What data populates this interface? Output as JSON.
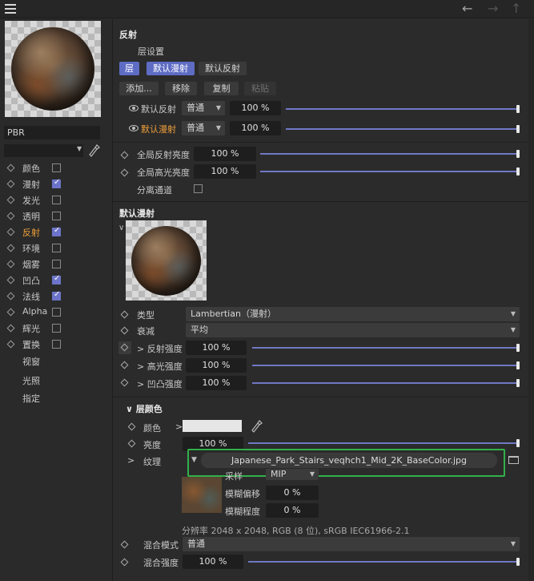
{
  "topbar": {
    "menu_icon": "hamburger-icon",
    "back_icon": "arrow-left-icon",
    "forward_icon": "arrow-right-icon",
    "up_icon": "arrow-up-icon"
  },
  "material": {
    "name": "PBR",
    "dropdown_value": ""
  },
  "channels": [
    {
      "label": "颜色",
      "checked": false,
      "active": false
    },
    {
      "label": "漫射",
      "checked": true,
      "active": false
    },
    {
      "label": "发光",
      "checked": false,
      "active": false
    },
    {
      "label": "透明",
      "checked": false,
      "active": false
    },
    {
      "label": "反射",
      "checked": true,
      "active": true
    },
    {
      "label": "环境",
      "checked": false,
      "active": false
    },
    {
      "label": "烟雾",
      "checked": false,
      "active": false
    },
    {
      "label": "凹凸",
      "checked": true,
      "active": false
    },
    {
      "label": "法线",
      "checked": true,
      "active": false
    },
    {
      "label": "Alpha",
      "checked": false,
      "active": false
    },
    {
      "label": "辉光",
      "checked": false,
      "active": false
    },
    {
      "label": "置换",
      "checked": false,
      "active": false
    }
  ],
  "extra_items": [
    "视窗",
    "光照",
    "指定"
  ],
  "reflection": {
    "title": "反射",
    "layer_settings": "层设置",
    "tabs": [
      "层",
      "默认漫射",
      "默认反射"
    ],
    "actions": [
      "添加...",
      "移除",
      "复制",
      "粘贴"
    ],
    "layers": [
      {
        "name": "默认反射",
        "mode": "普通",
        "value": "100 %",
        "active": false
      },
      {
        "name": "默认漫射",
        "mode": "普通",
        "value": "100 %",
        "active": true
      }
    ],
    "global_refl_label": "全局反射亮度",
    "global_refl_value": "100 %",
    "global_spec_label": "全局高光亮度",
    "global_spec_value": "100 %",
    "separate_pass_label": "分离通道"
  },
  "diffuse": {
    "title": "默认漫射",
    "type_label": "类型",
    "type_value": "Lambertian（漫射）",
    "attenuation_label": "衰减",
    "attenuation_value": "平均",
    "refl_strength_label": "反射强度",
    "refl_strength_value": "100 %",
    "spec_strength_label": "高光强度",
    "spec_strength_value": "100 %",
    "bump_strength_label": "凹凸强度",
    "bump_strength_value": "100 %"
  },
  "layer_color": {
    "title": "层颜色",
    "color_label": "颜色",
    "brightness_label": "亮度",
    "brightness_value": "100 %",
    "texture_label": "纹理",
    "texture_file": "Japanese_Park_Stairs_veqhch1_Mid_2K_BaseColor.jpg",
    "sampling_label": "采样",
    "sampling_value": "MIP",
    "blur_offset_label": "模糊偏移",
    "blur_offset_value": "0 %",
    "blur_scale_label": "模糊程度",
    "blur_scale_value": "0 %",
    "resolution_info": "分辨率 2048 x 2048, RGB (8 位), sRGB IEC61966-2.1",
    "blend_mode_label": "混合模式",
    "blend_mode_value": "普通",
    "blend_strength_label": "混合强度",
    "blend_strength_value": "100 %"
  },
  "colors": {
    "accent": "#5e6cc4",
    "active_text": "#f0a03a",
    "highlight": "#32b04a"
  }
}
